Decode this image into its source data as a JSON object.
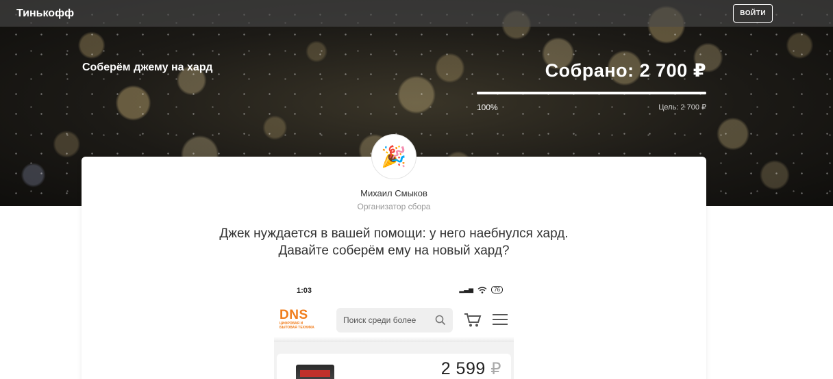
{
  "header": {
    "brand": "Тинькофф",
    "login_label": "ВОЙТИ"
  },
  "fundraiser": {
    "title": "Соберём джему на хард",
    "collected_text": "Собрано: 2 700 ₽",
    "progress_percent_label": "100%",
    "progress_fraction": 1.0,
    "goal_text": "Цель: 2 700 ₽"
  },
  "organizer": {
    "avatar_emoji": "🎉",
    "name": "Михаил Смыков",
    "role": "Организатор сбора"
  },
  "description": {
    "line1": "Джек нуждается в вашей помощи: у него наебнулся хард.",
    "line2": "Давайте соберём ему на новый хард?"
  },
  "embedded_screenshot": {
    "time": "1:03",
    "battery": "76",
    "logo_text": "DNS",
    "logo_subtitle_line1": "ЦИФРОВАЯ И",
    "logo_subtitle_line2": "БЫТОВАЯ ТЕХНИКА",
    "search_placeholder": "Поиск среди более",
    "price": "2 599",
    "currency": "₽"
  },
  "colors": {
    "dns_orange": "#f07c1a",
    "topbar": "#4b4b4b"
  }
}
